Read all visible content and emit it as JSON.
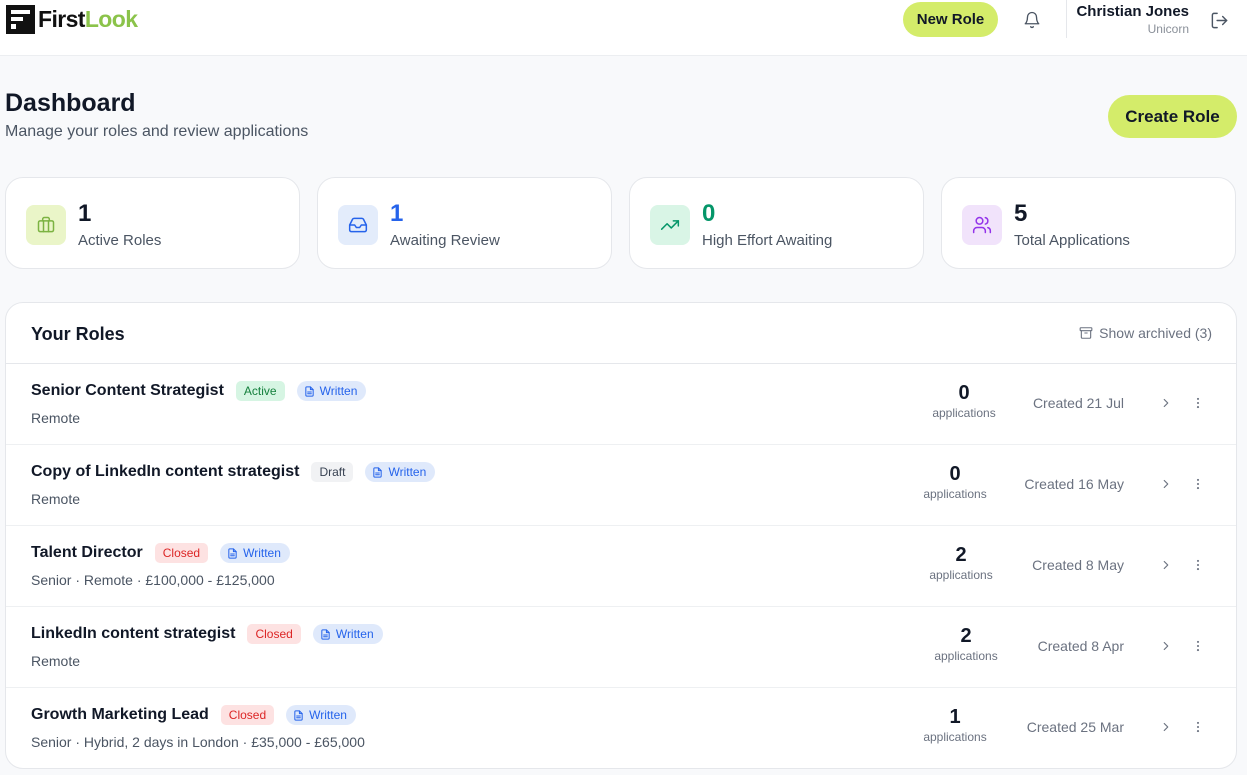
{
  "brand": {
    "first": "First",
    "look": "Look"
  },
  "header": {
    "new_role_label": "New Role",
    "user_name": "Christian Jones",
    "user_org": "Unicorn"
  },
  "page": {
    "title": "Dashboard",
    "subtitle": "Manage your roles and review applications",
    "create_role_label": "Create Role"
  },
  "stats": [
    {
      "value": "1",
      "label": "Active Roles",
      "icon": "briefcase-icon",
      "color": "#111827",
      "icon_bg": "#eaf5c8",
      "icon_color": "#7cb342"
    },
    {
      "value": "1",
      "label": "Awaiting Review",
      "icon": "inbox-icon",
      "color": "#2563eb",
      "icon_bg": "#e3ecfb",
      "icon_color": "#2563eb"
    },
    {
      "value": "0",
      "label": "High Effort Awaiting",
      "icon": "trending-up-icon",
      "color": "#059669",
      "icon_bg": "#d9f5e6",
      "icon_color": "#059669"
    },
    {
      "value": "5",
      "label": "Total Applications",
      "icon": "users-icon",
      "color": "#111827",
      "icon_bg": "#f1e3fb",
      "icon_color": "#9333ea"
    }
  ],
  "roles_panel": {
    "title": "Your Roles",
    "show_archived": "Show archived (3)"
  },
  "roles": [
    {
      "name": "Senior Content Strategist",
      "status": "Active",
      "type": "Written",
      "meta": "Remote",
      "count": "0",
      "count_label": "applications",
      "created": "Created 21 Jul"
    },
    {
      "name": "Copy of LinkedIn content strategist",
      "status": "Draft",
      "type": "Written",
      "meta": "Remote",
      "count": "0",
      "count_label": "applications",
      "created": "Created 16 May"
    },
    {
      "name": "Talent Director",
      "status": "Closed",
      "type": "Written",
      "meta": "Senior · Remote · £100,000 - £125,000",
      "count": "2",
      "count_label": "applications",
      "created": "Created 8 May"
    },
    {
      "name": "LinkedIn content strategist",
      "status": "Closed",
      "type": "Written",
      "meta": "Remote",
      "count": "2",
      "count_label": "applications",
      "created": "Created 8 Apr"
    },
    {
      "name": "Growth Marketing Lead",
      "status": "Closed",
      "type": "Written",
      "meta": "Senior · Hybrid, 2 days in London · £35,000 - £65,000",
      "count": "1",
      "count_label": "applications",
      "created": "Created 25 Mar"
    }
  ],
  "colors": {
    "accent": "#d4ec6a",
    "status_active": "#15803d",
    "status_closed": "#dc2626",
    "type_written": "#2563eb"
  }
}
